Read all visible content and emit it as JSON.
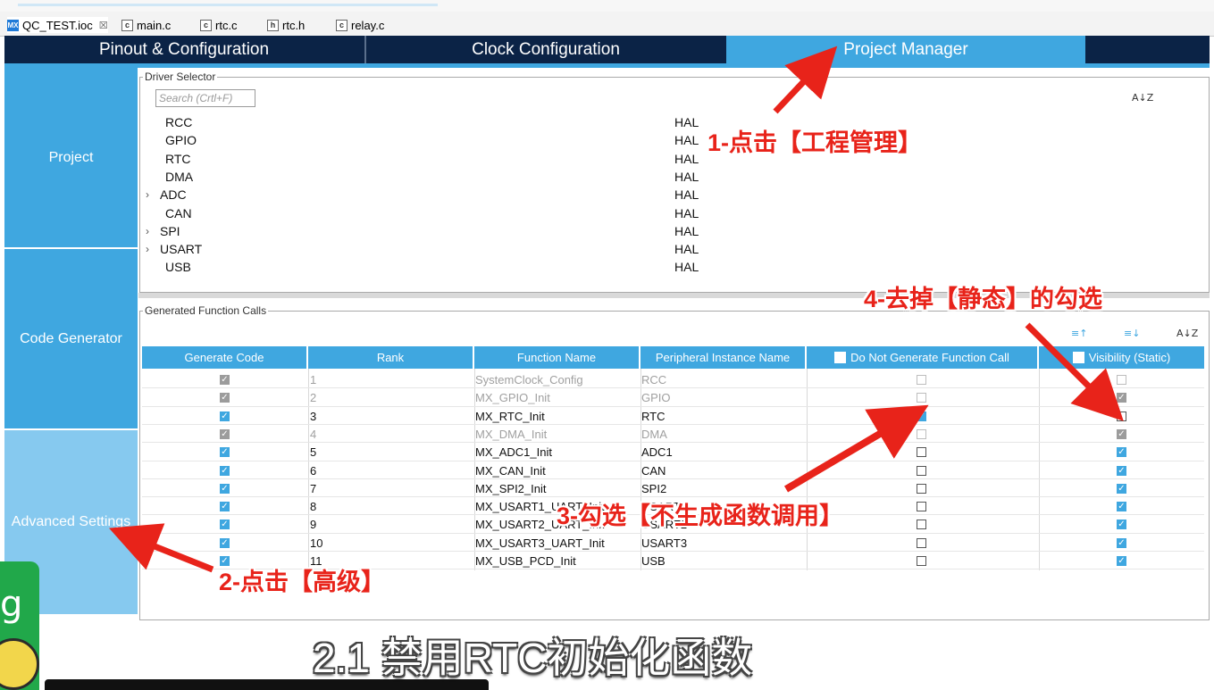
{
  "editor_tabs": [
    {
      "label": "QC_TEST.ioc",
      "icon": "MX",
      "close": "☒"
    },
    {
      "label": "main.c",
      "icon": "c"
    },
    {
      "label": "rtc.c",
      "icon": "c"
    },
    {
      "label": "rtc.h",
      "icon": "h"
    },
    {
      "label": "relay.c",
      "icon": "c"
    }
  ],
  "main_tabs": [
    "Pinout & Configuration",
    "Clock Configuration",
    "Project Manager"
  ],
  "sidebar": [
    "Project",
    "Code Generator",
    "Advanced Settings"
  ],
  "driver_selector": {
    "legend": "Driver Selector",
    "search_placeholder": "Search (Crtl+F)",
    "sort_icon": "A↓Z",
    "drivers": [
      {
        "name": "RCC",
        "value": "HAL",
        "expandable": false
      },
      {
        "name": "GPIO",
        "value": "HAL",
        "expandable": false
      },
      {
        "name": "RTC",
        "value": "HAL",
        "expandable": false
      },
      {
        "name": "DMA",
        "value": "HAL",
        "expandable": false
      },
      {
        "name": "ADC",
        "value": "HAL",
        "expandable": true
      },
      {
        "name": "CAN",
        "value": "HAL",
        "expandable": false
      },
      {
        "name": "SPI",
        "value": "HAL",
        "expandable": true
      },
      {
        "name": "USART",
        "value": "HAL",
        "expandable": true
      },
      {
        "name": "USB",
        "value": "HAL",
        "expandable": false
      }
    ]
  },
  "function_calls": {
    "legend": "Generated Function Calls",
    "columns": [
      "Generate Code",
      "Rank",
      "Function Name",
      "Peripheral Instance Name",
      "Do Not Generate Function Call",
      "Visibility (Static)"
    ],
    "rows": [
      {
        "rank": "1",
        "fn": "SystemClock_Config",
        "inst": "RCC",
        "gen": true,
        "nogen": false,
        "vis": false,
        "disabled": true
      },
      {
        "rank": "2",
        "fn": "MX_GPIO_Init",
        "inst": "GPIO",
        "gen": true,
        "nogen": false,
        "vis": true,
        "disabled": true
      },
      {
        "rank": "3",
        "fn": "MX_RTC_Init",
        "inst": "RTC",
        "gen": true,
        "nogen": true,
        "vis": false,
        "disabled": false
      },
      {
        "rank": "4",
        "fn": "MX_DMA_Init",
        "inst": "DMA",
        "gen": true,
        "nogen": false,
        "vis": true,
        "disabled": true
      },
      {
        "rank": "5",
        "fn": "MX_ADC1_Init",
        "inst": "ADC1",
        "gen": true,
        "nogen": false,
        "vis": true,
        "disabled": false
      },
      {
        "rank": "6",
        "fn": "MX_CAN_Init",
        "inst": "CAN",
        "gen": true,
        "nogen": false,
        "vis": true,
        "disabled": false
      },
      {
        "rank": "7",
        "fn": "MX_SPI2_Init",
        "inst": "SPI2",
        "gen": true,
        "nogen": false,
        "vis": true,
        "disabled": false
      },
      {
        "rank": "8",
        "fn": "MX_USART1_UART_Init",
        "inst": "USART1",
        "gen": true,
        "nogen": false,
        "vis": true,
        "disabled": false
      },
      {
        "rank": "9",
        "fn": "MX_USART2_UART_Init",
        "inst": "USART2",
        "gen": true,
        "nogen": false,
        "vis": true,
        "disabled": false
      },
      {
        "rank": "10",
        "fn": "MX_USART3_UART_Init",
        "inst": "USART3",
        "gen": true,
        "nogen": false,
        "vis": true,
        "disabled": false
      },
      {
        "rank": "11",
        "fn": "MX_USB_PCD_Init",
        "inst": "USB",
        "gen": true,
        "nogen": false,
        "vis": true,
        "disabled": false
      }
    ]
  },
  "annotations": {
    "a1": "1-点击【工程管理】",
    "a2": "2-点击【高级】",
    "a3": "3-勾选【不生成函数调用】",
    "a4": "4-去掉【静态】的勾选"
  },
  "subtitle": "2.1 禁用RTC初始化函数",
  "colors": {
    "accent": "#3fa7e0",
    "navy": "#0b2346",
    "annotation": "#e8231a"
  }
}
